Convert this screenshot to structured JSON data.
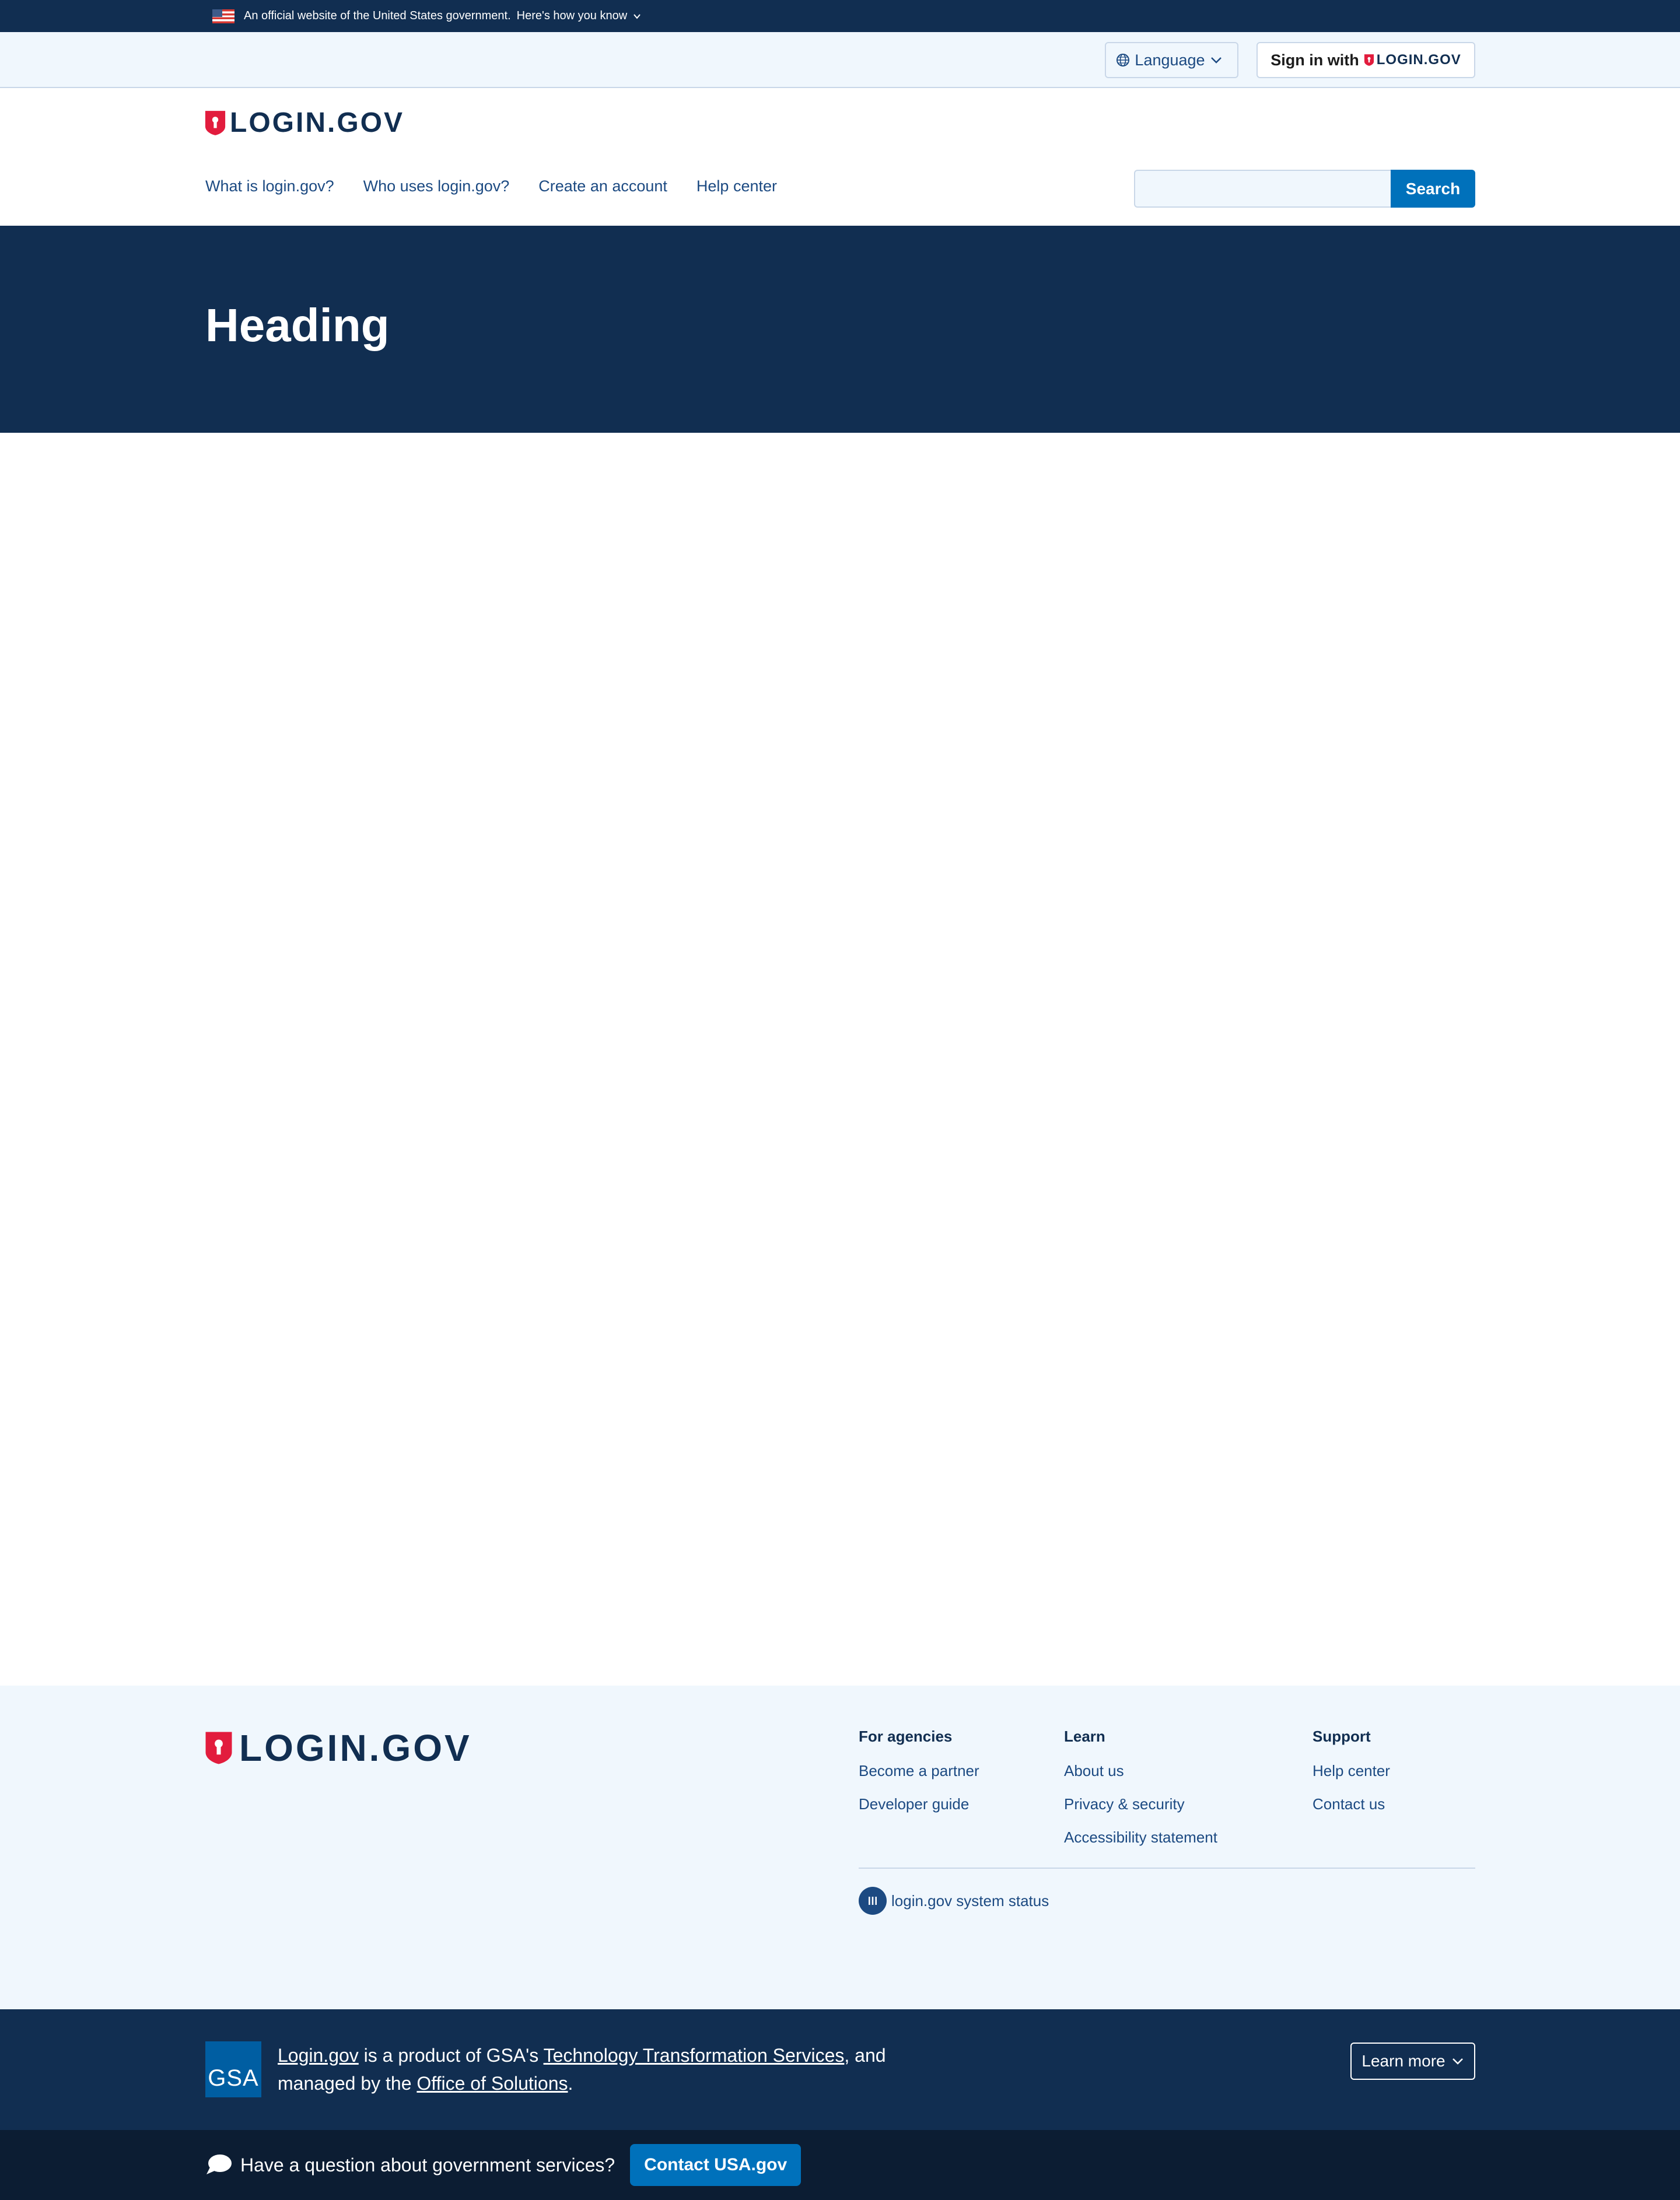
{
  "gov_banner": {
    "text": "An official website of the United States government.",
    "how_link": "Here's how you know"
  },
  "utility": {
    "language_label": "Language",
    "signin_prefix": "Sign in with",
    "signin_brand": "LOGIN.GOV"
  },
  "header": {
    "logo_text": "LOGIN.GOV",
    "nav": [
      "What is login.gov?",
      "Who uses login.gov?",
      "Create an account",
      "Help center"
    ],
    "search_value": "",
    "search_button": "Search"
  },
  "hero": {
    "heading": "Heading"
  },
  "footer": {
    "logo_text": "LOGIN.GOV",
    "columns": [
      {
        "heading": "For agencies",
        "links": [
          "Become a partner",
          "Developer guide"
        ]
      },
      {
        "heading": "Learn",
        "links": [
          "About us",
          "Privacy & security",
          "Accessibility statement"
        ]
      },
      {
        "heading": "Support",
        "links": [
          "Help center",
          "Contact us"
        ]
      }
    ],
    "status_link": "login.gov system status"
  },
  "gsa": {
    "logo_text": "GSA",
    "part1": "Login.gov",
    "part2": " is a product of GSA's ",
    "part3": "Technology Transformation Services",
    "part4": ", and managed by the ",
    "part5": "Office of Solutions",
    "part6": ".",
    "learn_more": "Learn more"
  },
  "usa": {
    "question": "Have a question about government services?",
    "contact_button": "Contact USA.gov"
  },
  "colors": {
    "navy": "#112e51",
    "primary_blue": "#0071bb",
    "link_blue": "#1c4a82",
    "light_bg": "#f0f7fd",
    "shield_red": "#e21c3d",
    "dark_bar": "#0c1d33"
  },
  "icons": [
    "us-flag-icon",
    "chevron-down-icon",
    "globe-icon",
    "shield-icon",
    "status-icon",
    "chat-bubble-icon"
  ]
}
